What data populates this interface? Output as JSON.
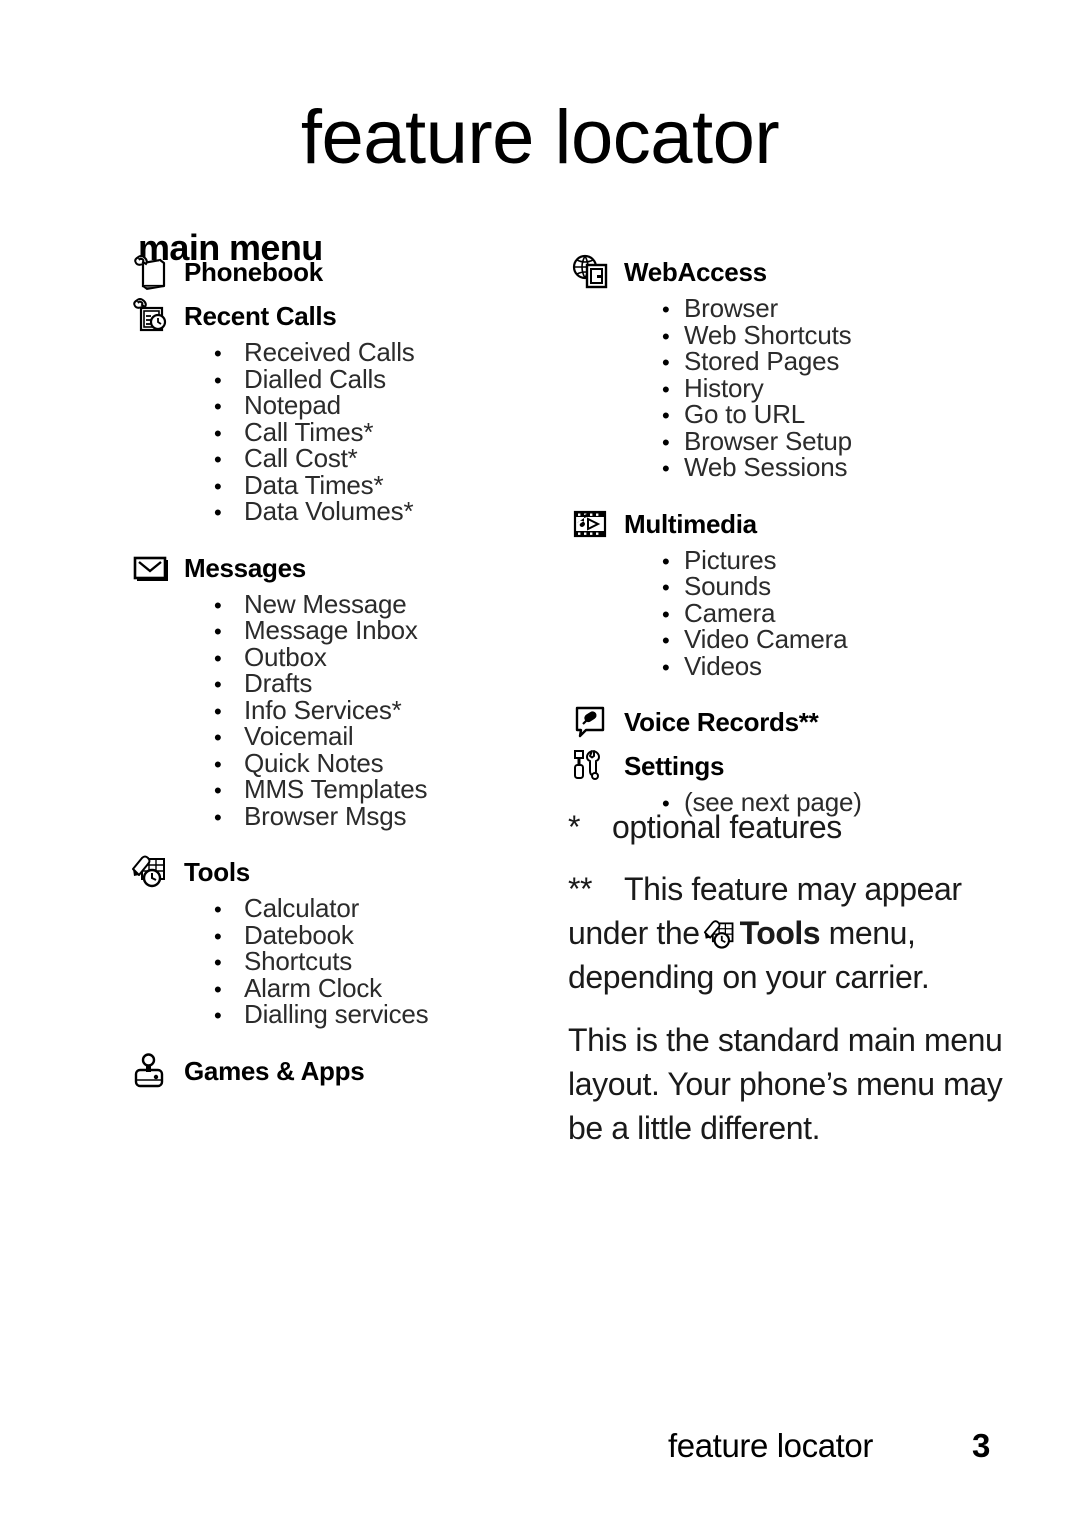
{
  "page": {
    "title": "feature locator",
    "section_title": "main menu",
    "footer_title": "feature locator",
    "footer_page_number": "3"
  },
  "left_column": [
    {
      "icon": "phonebook-icon",
      "label": "Phonebook",
      "items": []
    },
    {
      "icon": "recent-calls-icon",
      "label": "Recent Calls",
      "items": [
        "Received Calls",
        "Dialled Calls",
        "Notepad",
        "Call Times*",
        "Call Cost*",
        "Data Times*",
        "Data Volumes*"
      ]
    },
    {
      "icon": "messages-envelope-icon",
      "label": "Messages",
      "items": [
        "New Message",
        "Message Inbox",
        "Outbox",
        "Drafts",
        "Info Services*",
        "Voicemail",
        "Quick Notes",
        "MMS Templates",
        "Browser Msgs"
      ]
    },
    {
      "icon": "tools-icon",
      "label": "Tools",
      "items": [
        "Calculator",
        "Datebook",
        "Shortcuts",
        "Alarm Clock",
        "Dialling services"
      ]
    },
    {
      "icon": "games-joystick-icon",
      "label": "Games & Apps",
      "items": []
    }
  ],
  "right_column": [
    {
      "icon": "webaccess-globe-icon",
      "label": "WebAccess",
      "items": [
        "Browser",
        "Web Shortcuts",
        "Stored Pages",
        "History",
        "Go to URL",
        "Browser Setup",
        "Web Sessions"
      ]
    },
    {
      "icon": "multimedia-filmstrip-icon",
      "label": "Multimedia",
      "items": [
        "Pictures",
        "Sounds",
        "Camera",
        "Video Camera",
        "Videos"
      ]
    },
    {
      "icon": "voice-records-icon",
      "label": "Voice Records**",
      "items": []
    },
    {
      "icon": "settings-tools-icon",
      "label": "Settings",
      "items": [
        "(see next page)"
      ]
    }
  ],
  "notes": {
    "single_asterisk_mark": "*",
    "single_asterisk_text": "optional features",
    "double_asterisk_mark": "**",
    "double_asterisk_text_before": "This feature may appear under the",
    "double_asterisk_icon": "tools-icon",
    "double_asterisk_bold_word": "Tools",
    "double_asterisk_text_after": "menu, depending on your carrier.",
    "paragraph": "This is the standard main menu layout. Your phone’s menu may be a little different."
  },
  "bullet_glyph": "•",
  "colors": {
    "text": "#000000",
    "sub_text": "#2b2b2b",
    "background": "#ffffff"
  }
}
